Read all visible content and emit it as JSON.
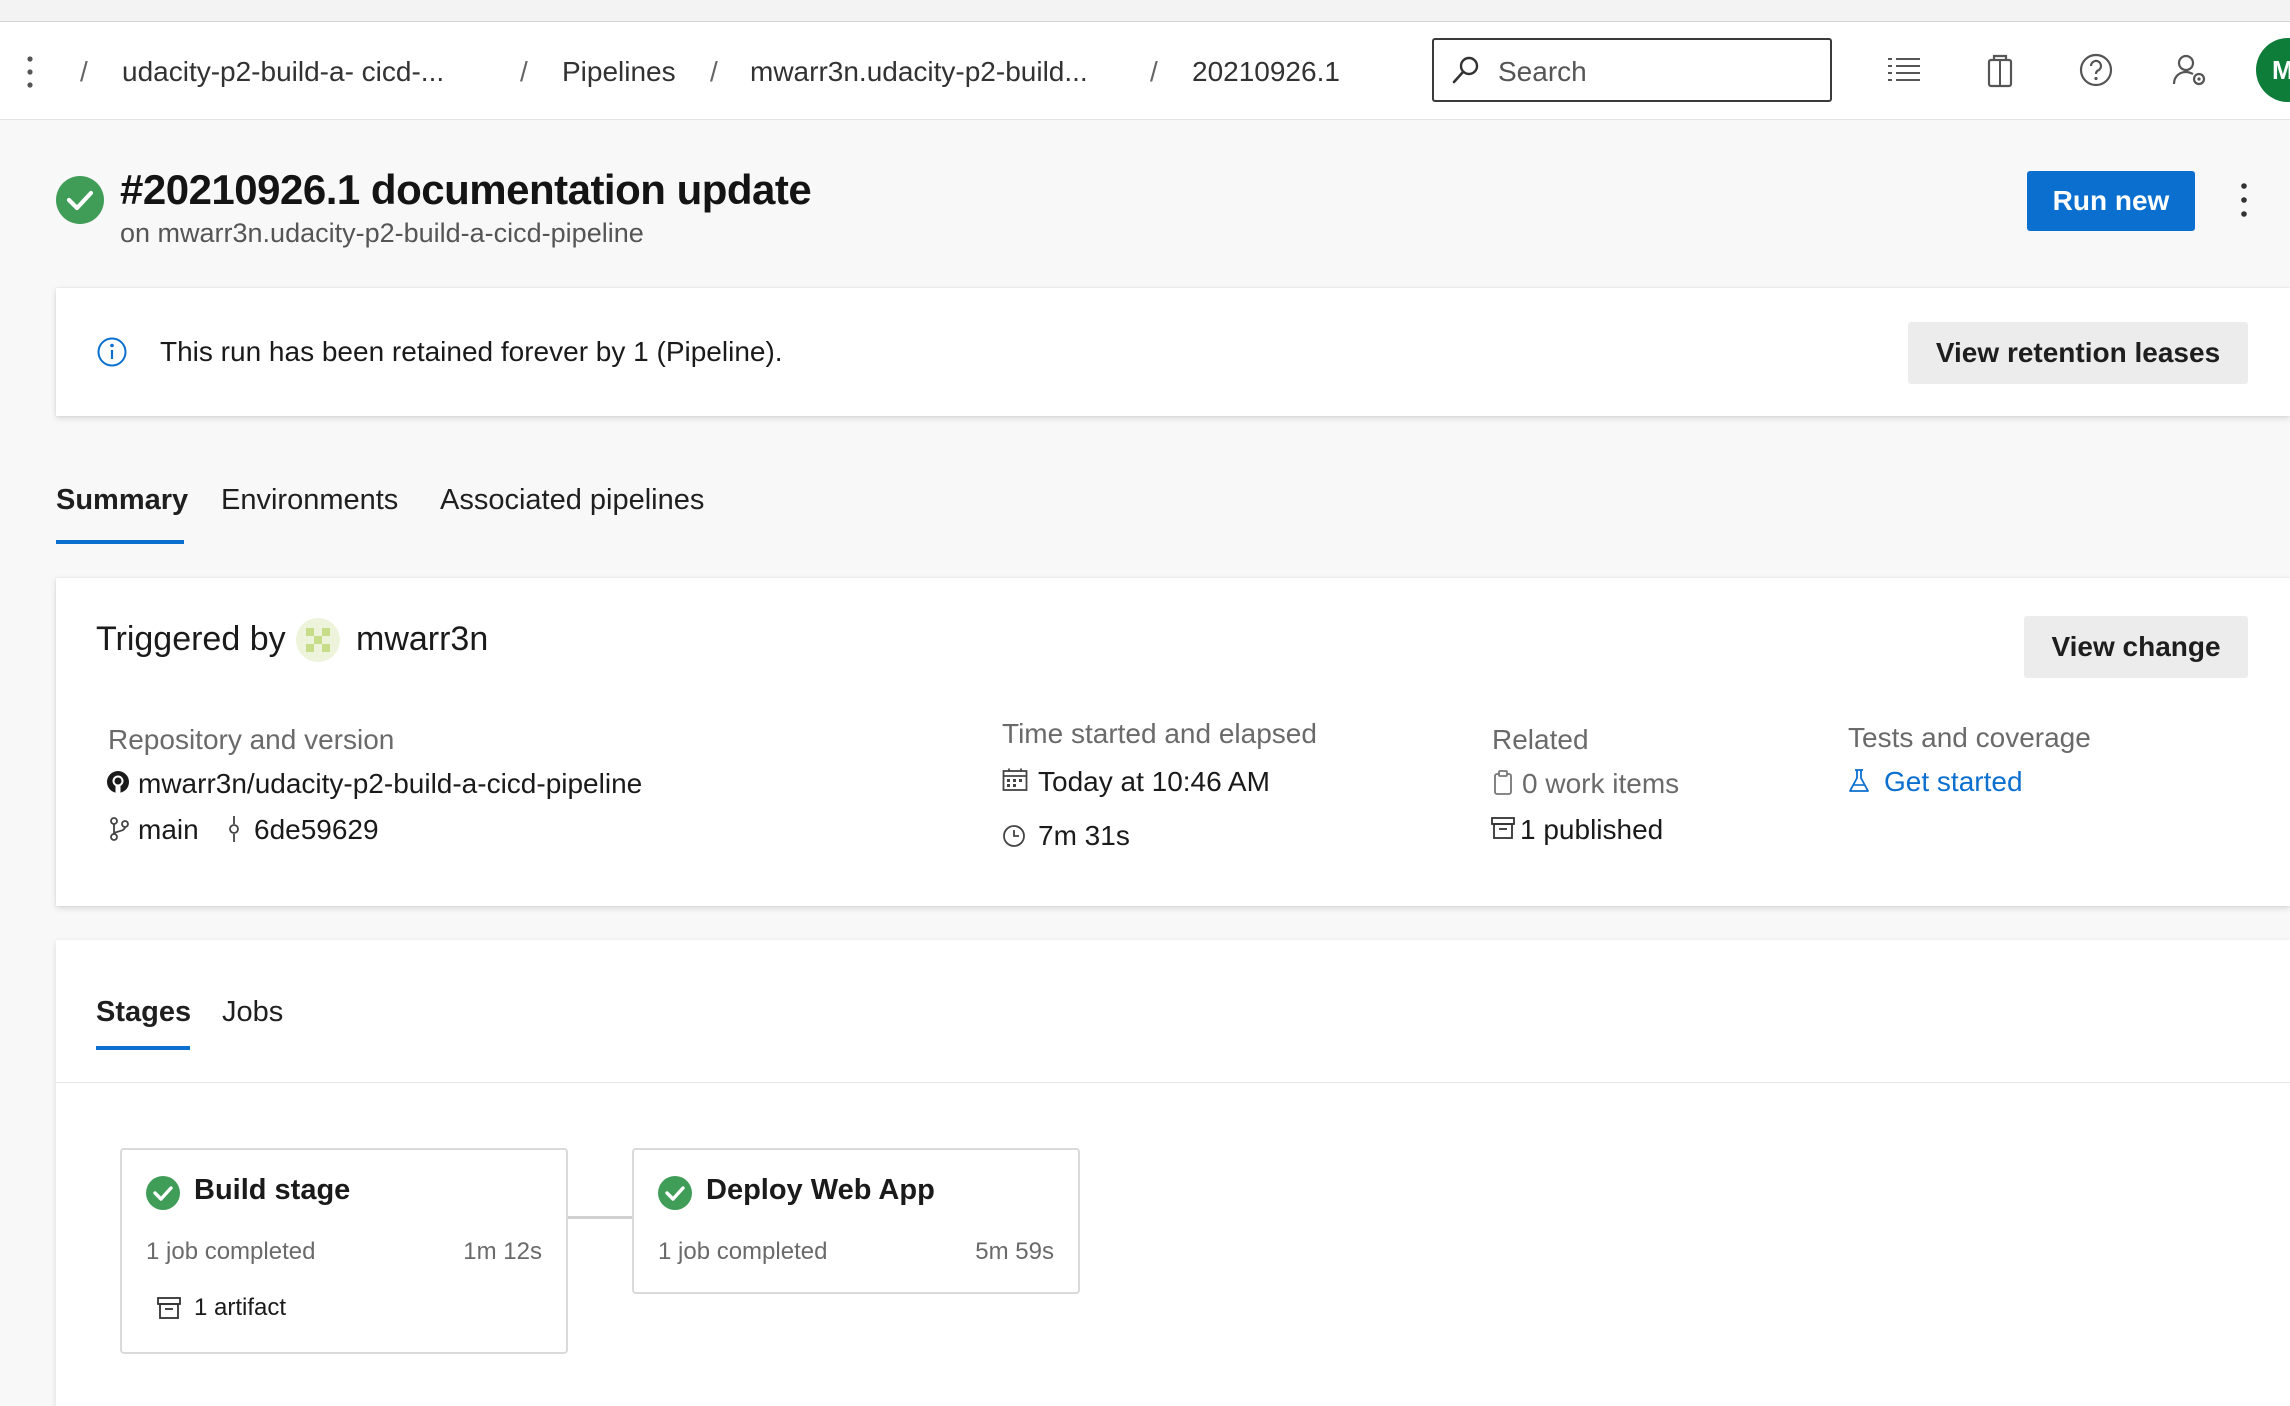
{
  "breadcrumb": {
    "project": "udacity-p2-build-a- cicd-...",
    "section": "Pipelines",
    "pipeline": "mwarr3n.udacity-p2-build...",
    "run": "20210926.1",
    "separator": "/"
  },
  "search": {
    "placeholder": "Search"
  },
  "header_icons": [
    "task-list-icon",
    "marketplace-bag-icon",
    "help-icon",
    "user-settings-icon"
  ],
  "user": {
    "initials": "M",
    "avatar_color": "#0f7d3a"
  },
  "run": {
    "title": "#20210926.1 documentation update",
    "subtitle": "on mwarr3n.udacity-p2-build-a-cicd-pipeline",
    "status": "succeeded",
    "run_new_label": "Run new"
  },
  "retention": {
    "message": "This run has been retained forever by 1 (Pipeline).",
    "button_label": "View retention leases"
  },
  "tabs": [
    {
      "label": "Summary",
      "active": true
    },
    {
      "label": "Environments",
      "active": false
    },
    {
      "label": "Associated pipelines",
      "active": false
    }
  ],
  "summary": {
    "triggered_label": "Triggered by",
    "triggered_user": "mwarr3n",
    "view_change_label": "View change",
    "repo_label": "Repository and version",
    "repo_name": "mwarr3n/udacity-p2-build-a-cicd-pipeline",
    "branch": "main",
    "commit": "6de59629",
    "time_label": "Time started and elapsed",
    "started": "Today at 10:46 AM",
    "elapsed": "7m 31s",
    "related_label": "Related",
    "work_items": "0 work items",
    "published": "1 published",
    "tests_label": "Tests and coverage",
    "tests_link": "Get started"
  },
  "stages_tabs": [
    {
      "label": "Stages",
      "active": true
    },
    {
      "label": "Jobs",
      "active": false
    }
  ],
  "stages": [
    {
      "name": "Build stage",
      "jobs": "1 job completed",
      "duration": "1m 12s",
      "artifact": "1 artifact",
      "status": "succeeded"
    },
    {
      "name": "Deploy Web App",
      "jobs": "1 job completed",
      "duration": "5m 59s",
      "status": "succeeded"
    }
  ],
  "colors": {
    "accent": "#0b6fcf",
    "success": "#3f9d58",
    "link": "#0b6fcf"
  }
}
